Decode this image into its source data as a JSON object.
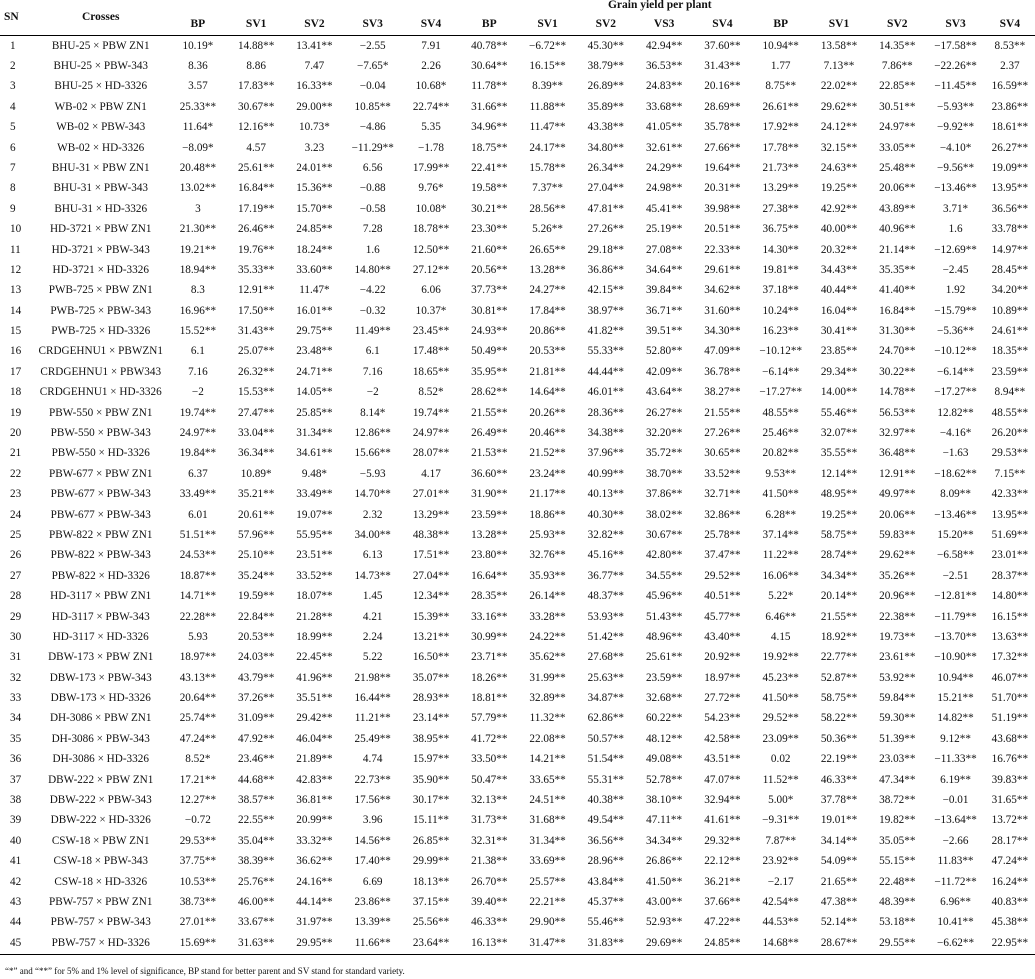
{
  "header": {
    "sn": "SN",
    "crosses": "Crosses",
    "group_title": "Grain yield per plant",
    "columns": [
      "BP",
      "SV1",
      "SV2",
      "SV3",
      "SV4",
      "BP",
      "SV1",
      "SV2",
      "VS3",
      "SV4",
      "BP",
      "SV1",
      "SV2",
      "SV3",
      "SV4"
    ]
  },
  "rows": [
    [
      "1",
      "BHU-25 × PBW ZN1",
      "10.19*",
      "14.88**",
      "13.41**",
      "−2.55",
      "7.91",
      "40.78**",
      "−6.72**",
      "45.30**",
      "42.94**",
      "37.60**",
      "10.94**",
      "13.58**",
      "14.35**",
      "−17.58**",
      "8.53**"
    ],
    [
      "2",
      "BHU-25 × PBW-343",
      "8.36",
      "8.86",
      "7.47",
      "−7.65*",
      "2.26",
      "30.64**",
      "16.15**",
      "38.79**",
      "36.53**",
      "31.43**",
      "1.77",
      "7.13**",
      "7.86**",
      "−22.26**",
      "2.37"
    ],
    [
      "3",
      "BHU-25 × HD-3326",
      "3.57",
      "17.83**",
      "16.33**",
      "−0.04",
      "10.68*",
      "11.78**",
      "8.39**",
      "26.89**",
      "24.83**",
      "20.16**",
      "8.75**",
      "22.02**",
      "22.85**",
      "−11.45**",
      "16.59**"
    ],
    [
      "4",
      "WB-02 × PBW ZN1",
      "25.33**",
      "30.67**",
      "29.00**",
      "10.85**",
      "22.74**",
      "31.66**",
      "11.88**",
      "35.89**",
      "33.68**",
      "28.69**",
      "26.61**",
      "29.62**",
      "30.51**",
      "−5.93**",
      "23.86**"
    ],
    [
      "5",
      "WB-02 × PBW-343",
      "11.64*",
      "12.16**",
      "10.73*",
      "−4.86",
      "5.35",
      "34.96**",
      "11.47**",
      "43.38**",
      "41.05**",
      "35.78**",
      "17.92**",
      "24.12**",
      "24.97**",
      "−9.92**",
      "18.61**"
    ],
    [
      "6",
      "WB-02 × HD-3326",
      "−8.09*",
      "4.57",
      "3.23",
      "−11.29**",
      "−1.78",
      "18.75**",
      "24.17**",
      "34.80**",
      "32.61**",
      "27.66**",
      "17.78**",
      "32.15**",
      "33.05**",
      "−4.10*",
      "26.27**"
    ],
    [
      "7",
      "BHU-31 × PBW ZN1",
      "20.48**",
      "25.61**",
      "24.01**",
      "6.56",
      "17.99**",
      "22.41**",
      "15.78**",
      "26.34**",
      "24.29**",
      "19.64**",
      "21.73**",
      "24.63**",
      "25.48**",
      "−9.56**",
      "19.09**"
    ],
    [
      "8",
      "BHU-31 × PBW-343",
      "13.02**",
      "16.84**",
      "15.36**",
      "−0.88",
      "9.76*",
      "19.58**",
      "7.37**",
      "27.04**",
      "24.98**",
      "20.31**",
      "13.29**",
      "19.25**",
      "20.06**",
      "−13.46**",
      "13.95**"
    ],
    [
      "9",
      "BHU-31 × HD-3326",
      "3",
      "17.19**",
      "15.70**",
      "−0.58",
      "10.08*",
      "30.21**",
      "28.56**",
      "47.81**",
      "45.41**",
      "39.98**",
      "27.38**",
      "42.92**",
      "43.89**",
      "3.71*",
      "36.56**"
    ],
    [
      "10",
      "HD-3721 × PBW ZN1",
      "21.30**",
      "26.46**",
      "24.85**",
      "7.28",
      "18.78**",
      "23.30**",
      "5.26**",
      "27.26**",
      "25.19**",
      "20.51**",
      "36.75**",
      "40.00**",
      "40.96**",
      "1.6",
      "33.78**"
    ],
    [
      "11",
      "HD-3721 × PBW-343",
      "19.21**",
      "19.76**",
      "18.24**",
      "1.6",
      "12.50**",
      "21.60**",
      "26.65**",
      "29.18**",
      "27.08**",
      "22.33**",
      "14.30**",
      "20.32**",
      "21.14**",
      "−12.69**",
      "14.97**"
    ],
    [
      "12",
      "HD-3721 × HD-3326",
      "18.94**",
      "35.33**",
      "33.60**",
      "14.80**",
      "27.12**",
      "20.56**",
      "13.28**",
      "36.86**",
      "34.64**",
      "29.61**",
      "19.81**",
      "34.43**",
      "35.35**",
      "−2.45",
      "28.45**"
    ],
    [
      "13",
      "PWB-725 × PBW ZN1",
      "8.3",
      "12.91**",
      "11.47*",
      "−4.22",
      "6.06",
      "37.73**",
      "24.27**",
      "42.15**",
      "39.84**",
      "34.62**",
      "37.18**",
      "40.44**",
      "41.40**",
      "1.92",
      "34.20**"
    ],
    [
      "14",
      "PWB-725 × PBW-343",
      "16.96**",
      "17.50**",
      "16.01**",
      "−0.32",
      "10.37*",
      "30.81**",
      "17.84**",
      "38.97**",
      "36.71**",
      "31.60**",
      "10.24**",
      "16.04**",
      "16.84**",
      "−15.79**",
      "10.89**"
    ],
    [
      "15",
      "PWB-725 × HD-3326",
      "15.52**",
      "31.43**",
      "29.75**",
      "11.49**",
      "23.45**",
      "24.93**",
      "20.86**",
      "41.82**",
      "39.51**",
      "34.30**",
      "16.23**",
      "30.41**",
      "31.30**",
      "−5.36**",
      "24.61**"
    ],
    [
      "16",
      "CRDGEHNU1 × PBWZN1",
      "6.1",
      "25.07**",
      "23.48**",
      "6.1",
      "17.48**",
      "50.49**",
      "20.53**",
      "55.33**",
      "52.80**",
      "47.09**",
      "−10.12**",
      "23.85**",
      "24.70**",
      "−10.12**",
      "18.35**"
    ],
    [
      "17",
      "CRDGEHNU1 × PBW343",
      "7.16",
      "26.32**",
      "24.71**",
      "7.16",
      "18.65**",
      "35.95**",
      "21.81**",
      "44.44**",
      "42.09**",
      "36.78**",
      "−6.14**",
      "29.34**",
      "30.22**",
      "−6.14**",
      "23.59**"
    ],
    [
      "18",
      "CRDGEHNU1 × HD-3326",
      "−2",
      "15.53**",
      "14.05**",
      "−2",
      "8.52*",
      "28.62**",
      "14.64**",
      "46.01**",
      "43.64**",
      "38.27**",
      "−17.27**",
      "14.00**",
      "14.78**",
      "−17.27**",
      "8.94**"
    ],
    [
      "19",
      "PBW-550 × PBW ZN1",
      "19.74**",
      "27.47**",
      "25.85**",
      "8.14*",
      "19.74**",
      "21.55**",
      "20.26**",
      "28.36**",
      "26.27**",
      "21.55**",
      "48.55**",
      "55.46**",
      "56.53**",
      "12.82**",
      "48.55**"
    ],
    [
      "20",
      "PBW-550 × PBW-343",
      "24.97**",
      "33.04**",
      "31.34**",
      "12.86**",
      "24.97**",
      "26.49**",
      "20.46**",
      "34.38**",
      "32.20**",
      "27.26**",
      "25.46**",
      "32.07**",
      "32.97**",
      "−4.16*",
      "26.20**"
    ],
    [
      "21",
      "PBW-550 × HD-3326",
      "19.84**",
      "36.34**",
      "34.61**",
      "15.66**",
      "28.07**",
      "21.53**",
      "21.52**",
      "37.96**",
      "35.72**",
      "30.65**",
      "20.82**",
      "35.55**",
      "36.48**",
      "−1.63",
      "29.53**"
    ],
    [
      "22",
      "PBW-677 × PBW ZN1",
      "6.37",
      "10.89*",
      "9.48*",
      "−5.93",
      "4.17",
      "36.60**",
      "23.24**",
      "40.99**",
      "38.70**",
      "33.52**",
      "9.53**",
      "12.14**",
      "12.91**",
      "−18.62**",
      "7.15**"
    ],
    [
      "23",
      "PBW-677 × PBW-343",
      "33.49**",
      "35.21**",
      "33.49**",
      "14.70**",
      "27.01**",
      "31.90**",
      "21.17**",
      "40.13**",
      "37.86**",
      "32.71**",
      "41.50**",
      "48.95**",
      "49.97**",
      "8.09**",
      "42.33**"
    ],
    [
      "24",
      "PBW-677 × PBW-343",
      "6.01",
      "20.61**",
      "19.07**",
      "2.32",
      "13.29**",
      "23.59**",
      "18.86**",
      "40.30**",
      "38.02**",
      "32.86**",
      "6.28**",
      "19.25**",
      "20.06**",
      "−13.46**",
      "13.95**"
    ],
    [
      "25",
      "PBW-822 × PBW ZN1",
      "51.51**",
      "57.96**",
      "55.95**",
      "34.00**",
      "48.38**",
      "13.28**",
      "25.93**",
      "32.82**",
      "30.67**",
      "25.78**",
      "37.14**",
      "58.75**",
      "59.83**",
      "15.20**",
      "51.69**"
    ],
    [
      "26",
      "PBW-822 × PBW-343",
      "24.53**",
      "25.10**",
      "23.51**",
      "6.13",
      "17.51**",
      "23.80**",
      "32.76**",
      "45.16**",
      "42.80**",
      "37.47**",
      "11.22**",
      "28.74**",
      "29.62**",
      "−6.58**",
      "23.01**"
    ],
    [
      "27",
      "PBW-822 × HD-3326",
      "18.87**",
      "35.24**",
      "33.52**",
      "14.73**",
      "27.04**",
      "16.64**",
      "35.93**",
      "36.77**",
      "34.55**",
      "29.52**",
      "16.06**",
      "34.34**",
      "35.26**",
      "−2.51",
      "28.37**"
    ],
    [
      "28",
      "HD-3117 × PBW ZN1",
      "14.71**",
      "19.59**",
      "18.07**",
      "1.45",
      "12.34**",
      "28.35**",
      "26.14**",
      "48.37**",
      "45.96**",
      "40.51**",
      "5.22*",
      "20.14**",
      "20.96**",
      "−12.81**",
      "14.80**"
    ],
    [
      "29",
      "HD-3117 × PBW-343",
      "22.28**",
      "22.84**",
      "21.28**",
      "4.21",
      "15.39**",
      "33.16**",
      "33.28**",
      "53.93**",
      "51.43**",
      "45.77**",
      "6.46**",
      "21.55**",
      "22.38**",
      "−11.79**",
      "16.15**"
    ],
    [
      "30",
      "HD-3117 × HD-3326",
      "5.93",
      "20.53**",
      "18.99**",
      "2.24",
      "13.21**",
      "30.99**",
      "24.22**",
      "51.42**",
      "48.96**",
      "43.40**",
      "4.15",
      "18.92**",
      "19.73**",
      "−13.70**",
      "13.63**"
    ],
    [
      "31",
      "DBW-173 × PBW ZN1",
      "18.97**",
      "24.03**",
      "22.45**",
      "5.22",
      "16.50**",
      "23.71**",
      "35.62**",
      "27.68**",
      "25.61**",
      "20.92**",
      "19.92**",
      "22.77**",
      "23.61**",
      "−10.90**",
      "17.32**"
    ],
    [
      "32",
      "DBW-173 × PBW-343",
      "43.13**",
      "43.79**",
      "41.96**",
      "21.98**",
      "35.07**",
      "18.26**",
      "31.99**",
      "25.63**",
      "23.59**",
      "18.97**",
      "45.23**",
      "52.87**",
      "53.92**",
      "10.94**",
      "46.07**"
    ],
    [
      "33",
      "DBW-173 × HD-3326",
      "20.64**",
      "37.26**",
      "35.51**",
      "16.44**",
      "28.93**",
      "18.81**",
      "32.89**",
      "34.87**",
      "32.68**",
      "27.72**",
      "41.50**",
      "58.75**",
      "59.84**",
      "15.21**",
      "51.70**"
    ],
    [
      "34",
      "DH-3086 × PBW ZN1",
      "25.74**",
      "31.09**",
      "29.42**",
      "11.21**",
      "23.14**",
      "57.79**",
      "11.32**",
      "62.86**",
      "60.22**",
      "54.23**",
      "29.52**",
      "58.22**",
      "59.30**",
      "14.82**",
      "51.19**"
    ],
    [
      "35",
      "DH-3086 × PBW-343",
      "47.24**",
      "47.92**",
      "46.04**",
      "25.49**",
      "38.95**",
      "41.72**",
      "22.08**",
      "50.57**",
      "48.12**",
      "42.58**",
      "23.09**",
      "50.36**",
      "51.39**",
      "9.12**",
      "43.68**"
    ],
    [
      "36",
      "DH-3086 × HD-3326",
      "8.52*",
      "23.46**",
      "21.89**",
      "4.74",
      "15.97**",
      "33.50**",
      "14.21**",
      "51.54**",
      "49.08**",
      "43.51**",
      "0.02",
      "22.19**",
      "23.03**",
      "−11.33**",
      "16.76**"
    ],
    [
      "37",
      "DBW-222 × PBW ZN1",
      "17.21**",
      "44.68**",
      "42.83**",
      "22.73**",
      "35.90**",
      "50.47**",
      "33.65**",
      "55.31**",
      "52.78**",
      "47.07**",
      "11.52**",
      "46.33**",
      "47.34**",
      "6.19**",
      "39.83**"
    ],
    [
      "38",
      "DBW-222 × PBW-343",
      "12.27**",
      "38.57**",
      "36.81**",
      "17.56**",
      "30.17**",
      "32.13**",
      "24.51**",
      "40.38**",
      "38.10**",
      "32.94**",
      "5.00*",
      "37.78**",
      "38.72**",
      "−0.01",
      "31.65**"
    ],
    [
      "39",
      "DBW-222 × HD-3326",
      "−0.72",
      "22.55**",
      "20.99**",
      "3.96",
      "15.11**",
      "31.73**",
      "31.68**",
      "49.54**",
      "47.11**",
      "41.61**",
      "−9.31**",
      "19.01**",
      "19.82**",
      "−13.64**",
      "13.72**"
    ],
    [
      "40",
      "CSW-18 × PBW ZN1",
      "29.53**",
      "35.04**",
      "33.32**",
      "14.56**",
      "26.85**",
      "32.31**",
      "31.34**",
      "36.56**",
      "34.34**",
      "29.32**",
      "7.87**",
      "34.14**",
      "35.05**",
      "−2.66",
      "28.17**"
    ],
    [
      "41",
      "CSW-18 × PBW-343",
      "37.75**",
      "38.39**",
      "36.62**",
      "17.40**",
      "29.99**",
      "21.38**",
      "33.69**",
      "28.96**",
      "26.86**",
      "22.12**",
      "23.92**",
      "54.09**",
      "55.15**",
      "11.83**",
      "47.24**"
    ],
    [
      "42",
      "CSW-18 × HD-3326",
      "10.53**",
      "25.76**",
      "24.16**",
      "6.69",
      "18.13**",
      "26.70**",
      "25.57**",
      "43.84**",
      "41.50**",
      "36.21**",
      "−2.17",
      "21.65**",
      "22.48**",
      "−11.72**",
      "16.24**"
    ],
    [
      "43",
      "PBW-757 × PBW ZN1",
      "38.73**",
      "46.00**",
      "44.14**",
      "23.86**",
      "37.15**",
      "39.40**",
      "22.21**",
      "45.37**",
      "43.00**",
      "37.66**",
      "42.54**",
      "47.38**",
      "48.39**",
      "6.96**",
      "40.83**"
    ],
    [
      "44",
      "PBW-757 × PBW-343",
      "27.01**",
      "33.67**",
      "31.97**",
      "13.39**",
      "25.56**",
      "46.33**",
      "29.90**",
      "55.46**",
      "52.93**",
      "47.22**",
      "44.53**",
      "52.14**",
      "53.18**",
      "10.41**",
      "45.38**"
    ],
    [
      "45",
      "PBW-757 × HD-3326",
      "15.69**",
      "31.63**",
      "29.95**",
      "11.66**",
      "23.64**",
      "16.13**",
      "31.47**",
      "31.83**",
      "29.69**",
      "24.85**",
      "14.68**",
      "28.67**",
      "29.55**",
      "−6.62**",
      "22.95**"
    ]
  ],
  "footnote": "“*” and “**” for 5% and 1% level of significance, BP stand for better parent and SV stand for standard variety."
}
